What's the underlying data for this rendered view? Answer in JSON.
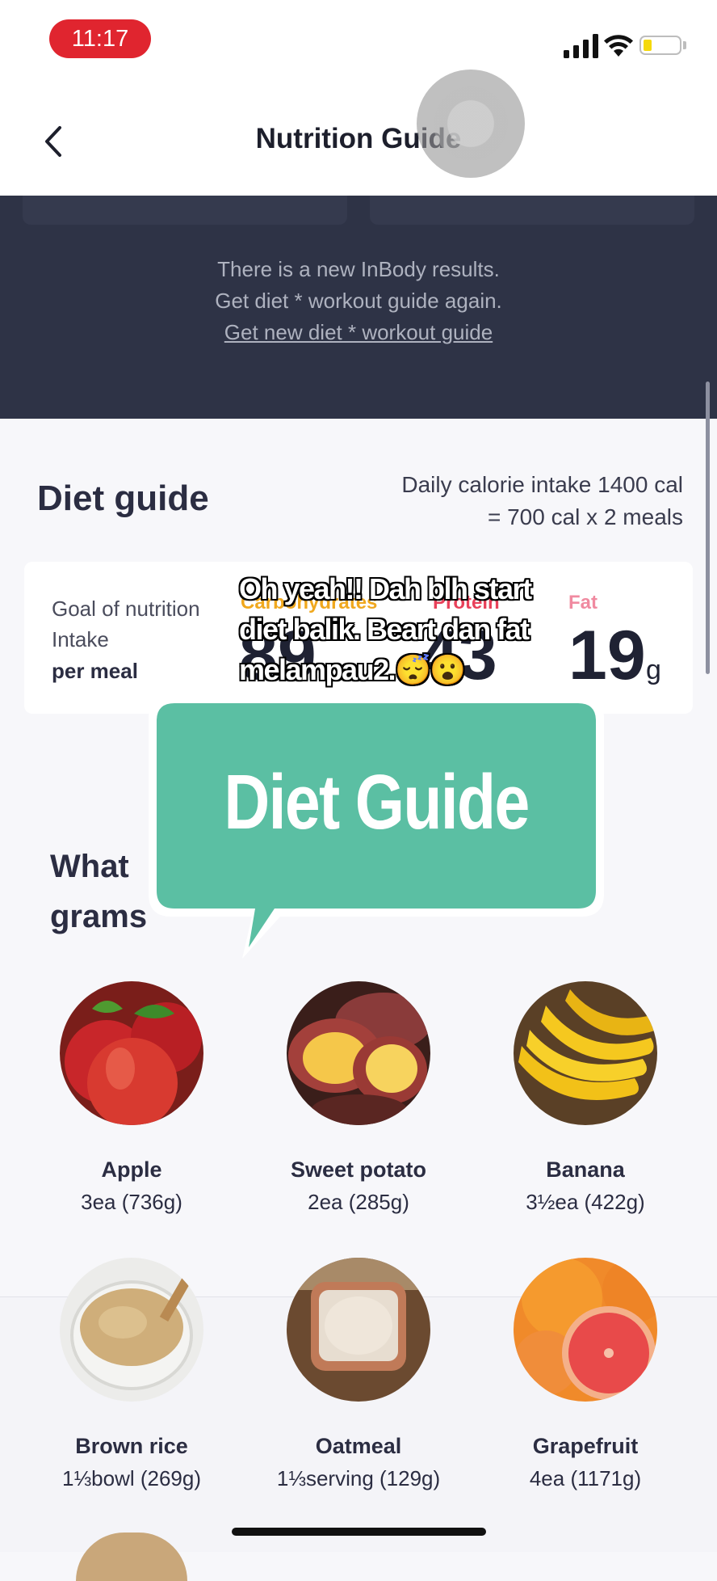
{
  "status_bar": {
    "time": "11:17"
  },
  "nav": {
    "title": "Nutrition Guide"
  },
  "banner": {
    "line1": "There is a new InBody results.",
    "line2": "Get diet * workout guide again.",
    "link": "Get new diet * workout guide"
  },
  "diet_guide": {
    "title": "Diet guide",
    "calorie_line1": "Daily calorie intake 1400 cal",
    "calorie_line2": "= 700 cal x 2 meals",
    "goal_line1": "Goal of nutrition",
    "goal_line2": "Intake",
    "goal_line3": "per meal",
    "macros": [
      {
        "label": "Carbohydrates",
        "value": "89",
        "color": "#f0a81e"
      },
      {
        "label": "Protein",
        "value": "43",
        "color": "#e8415a"
      },
      {
        "label": "Fat",
        "value": "19",
        "unit": "g",
        "color": "#f08aa0"
      }
    ]
  },
  "overlay": {
    "caption": "Oh yeah!! Dah blh start diet balik. Beart dan fat melampau2.😴😮",
    "bubble_text": "Diet Guide",
    "bubble_color": "#5bbfa3"
  },
  "question": {
    "line1": "What",
    "line2": "grams"
  },
  "foods": [
    {
      "name": "Apple",
      "qty": "3ea (736g)",
      "icon": "apple-icon"
    },
    {
      "name": "Sweet potato",
      "qty": "2ea (285g)",
      "icon": "sweet-potato-icon"
    },
    {
      "name": "Banana",
      "qty": "3½ea (422g)",
      "icon": "banana-icon"
    },
    {
      "name": "Brown rice",
      "qty": "1⅓bowl (269g)",
      "icon": "brown-rice-icon"
    },
    {
      "name": "Oatmeal",
      "qty": "1⅓serving (129g)",
      "icon": "oatmeal-icon"
    },
    {
      "name": "Grapefruit",
      "qty": "4ea (1171g)",
      "icon": "grapefruit-icon"
    }
  ]
}
